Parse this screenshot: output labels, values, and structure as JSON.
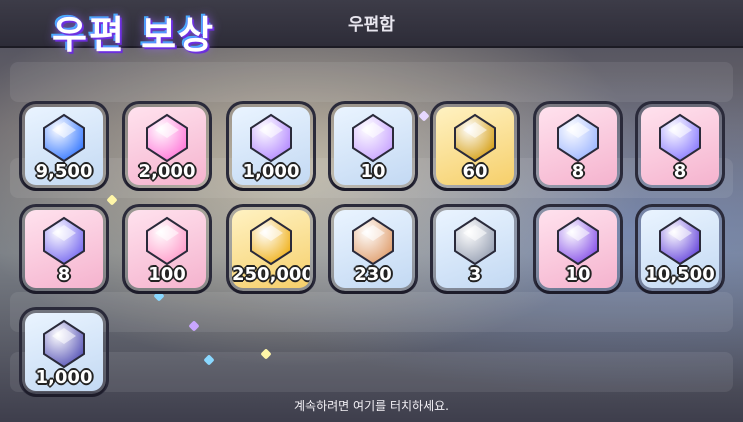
{
  "header": {
    "mail_title": "우편함",
    "reward_title": "우편 보상"
  },
  "rewards": [
    {
      "icon": "blue-crystal-icon",
      "qty": "9,500",
      "frame": "blue",
      "color": "#3a7bff"
    },
    {
      "icon": "rainbow-cube-icon",
      "qty": "2,000",
      "frame": "pink",
      "color": "#ff7ad9"
    },
    {
      "icon": "rainbow-star-icon",
      "qty": "1,000",
      "frame": "blue",
      "color": "#b58cff"
    },
    {
      "icon": "magic-cookie-cutter-icon",
      "qty": "10",
      "frame": "blue",
      "color": "#c9a6ff"
    },
    {
      "icon": "gold-crest-icon",
      "qty": "60",
      "frame": "gold",
      "color": "#d7a21b"
    },
    {
      "icon": "pillar-scroll-icon",
      "qty": "8",
      "frame": "pink",
      "color": "#9fb7ff"
    },
    {
      "icon": "ancient-stone-icon",
      "qty": "8",
      "frame": "pink",
      "color": "#8c7dff"
    },
    {
      "icon": "gear-crest-icon",
      "qty": "8",
      "frame": "pink",
      "color": "#7a6cf0"
    },
    {
      "icon": "candy-jar-icon",
      "qty": "100",
      "frame": "pink",
      "color": "#ff9ecb"
    },
    {
      "icon": "gold-coin-icon",
      "qty": "250,000",
      "frame": "gold",
      "color": "#f0b320"
    },
    {
      "icon": "biscuit-shard-icon",
      "qty": "230",
      "frame": "blue",
      "color": "#e0a070"
    },
    {
      "icon": "cookie-cutter-icon",
      "qty": "3",
      "frame": "blue",
      "color": "#9aa3b5"
    },
    {
      "icon": "purple-ticket-icon",
      "qty": "10",
      "frame": "pink",
      "color": "#8a55e8"
    },
    {
      "icon": "purple-crystal-icon",
      "qty": "10,500",
      "frame": "blue",
      "color": "#6a4bdc"
    },
    {
      "icon": "tower-emblem-icon",
      "qty": "1,000",
      "frame": "blue",
      "color": "#5b58b8"
    }
  ],
  "footer": {
    "hint": "계속하려면 여기를 터치하세요."
  }
}
